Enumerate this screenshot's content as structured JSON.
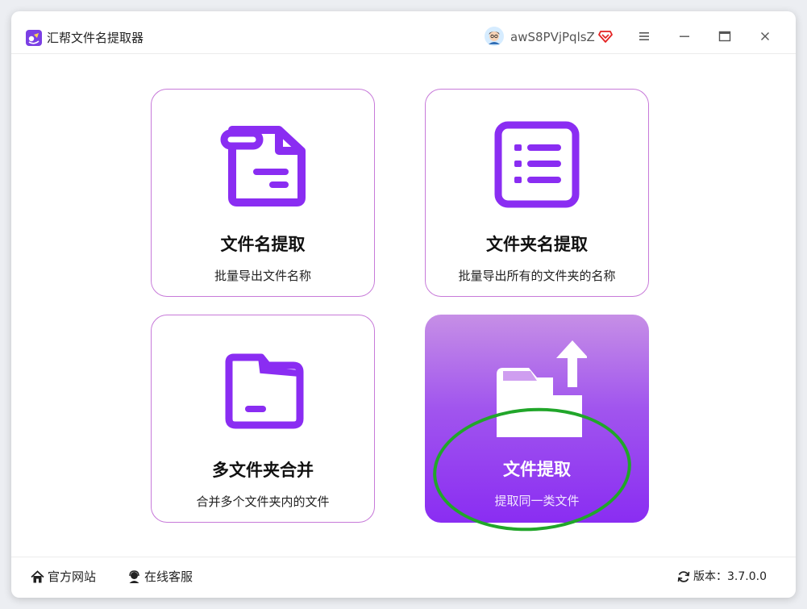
{
  "app": {
    "title": "汇帮文件名提取器",
    "username": "awS8PVjPqlsZ"
  },
  "colors": {
    "accent": "#8a2df2",
    "card_border": "#c77ad9",
    "highlight": "#21a62a"
  },
  "cards": [
    {
      "title": "文件名提取",
      "desc": "批量导出文件名称",
      "icon": "file-icon"
    },
    {
      "title": "文件夹名提取",
      "desc": "批量导出所有的文件夹的名称",
      "icon": "list-icon"
    },
    {
      "title": "多文件夹合并",
      "desc": "合并多个文件夹内的文件",
      "icon": "folder-icon"
    },
    {
      "title": "文件提取",
      "desc": "提取同一类文件",
      "icon": "folder-upload-icon",
      "selected": true
    }
  ],
  "footer": {
    "website": "官方网站",
    "support": "在线客服",
    "version_label": "版本：",
    "version": "3.7.0.0"
  }
}
